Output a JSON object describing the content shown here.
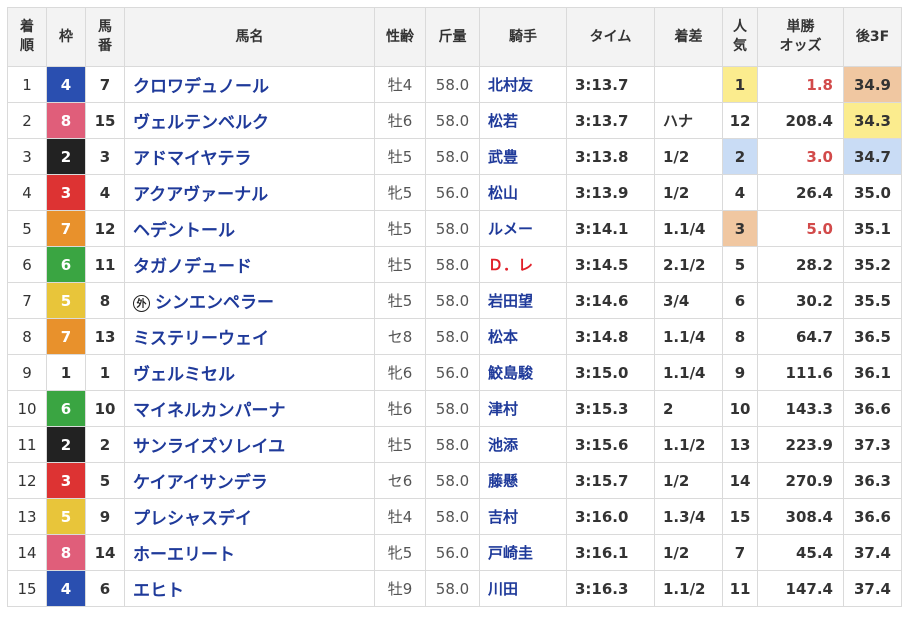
{
  "headers": {
    "rank": "着\n順",
    "waku": "枠",
    "umaban": "馬\n番",
    "name": "馬名",
    "sexage": "性齢",
    "weight": "斤量",
    "jockey": "騎手",
    "time": "タイム",
    "margin": "着差",
    "pop": "人\n気",
    "odds": "単勝\nオッズ",
    "last3f": "後3F"
  },
  "waku_colors": {
    "1": {
      "bg": "#ffffff",
      "fg": "#333333"
    },
    "2": {
      "bg": "#222222",
      "fg": "#ffffff"
    },
    "3": {
      "bg": "#dd3333",
      "fg": "#ffffff"
    },
    "4": {
      "bg": "#2a4fb0",
      "fg": "#ffffff"
    },
    "5": {
      "bg": "#e8c53a",
      "fg": "#ffffff"
    },
    "6": {
      "bg": "#3aa542",
      "fg": "#ffffff"
    },
    "7": {
      "bg": "#e8912c",
      "fg": "#ffffff"
    },
    "8": {
      "bg": "#e05e7a",
      "fg": "#ffffff"
    }
  },
  "highlight_colors": {
    "gold": "#fbec8e",
    "silver": "#c9dcf5",
    "bronze": "#f0c7a1"
  },
  "rows": [
    {
      "rank": "1",
      "waku": "4",
      "umaban": "7",
      "name": "クロワデュノール",
      "foreign": false,
      "sexage": "牡4",
      "weight": "58.0",
      "jockey": "北村友",
      "jockey_red": false,
      "time": "3:13.7",
      "margin": "",
      "pop": "1",
      "odds": "1.8",
      "odds_red": true,
      "last3f": "34.9",
      "pop_hl": "gold",
      "last3f_hl": "bronze"
    },
    {
      "rank": "2",
      "waku": "8",
      "umaban": "15",
      "name": "ヴェルテンベルク",
      "foreign": false,
      "sexage": "牡6",
      "weight": "58.0",
      "jockey": "松若",
      "jockey_red": false,
      "time": "3:13.7",
      "margin": "ハナ",
      "pop": "12",
      "odds": "208.4",
      "odds_red": false,
      "last3f": "34.3",
      "pop_hl": "",
      "last3f_hl": "gold"
    },
    {
      "rank": "3",
      "waku": "2",
      "umaban": "3",
      "name": "アドマイヤテラ",
      "foreign": false,
      "sexage": "牡5",
      "weight": "58.0",
      "jockey": "武豊",
      "jockey_red": false,
      "time": "3:13.8",
      "margin": "1/2",
      "pop": "2",
      "odds": "3.0",
      "odds_red": true,
      "last3f": "34.7",
      "pop_hl": "silver",
      "last3f_hl": "silver"
    },
    {
      "rank": "4",
      "waku": "3",
      "umaban": "4",
      "name": "アクアヴァーナル",
      "foreign": false,
      "sexage": "牝5",
      "weight": "56.0",
      "jockey": "松山",
      "jockey_red": false,
      "time": "3:13.9",
      "margin": "1/2",
      "pop": "4",
      "odds": "26.4",
      "odds_red": false,
      "last3f": "35.0",
      "pop_hl": "",
      "last3f_hl": ""
    },
    {
      "rank": "5",
      "waku": "7",
      "umaban": "12",
      "name": "ヘデントール",
      "foreign": false,
      "sexage": "牡5",
      "weight": "58.0",
      "jockey": "ルメー",
      "jockey_red": false,
      "time": "3:14.1",
      "margin": "1.1/4",
      "pop": "3",
      "odds": "5.0",
      "odds_red": true,
      "last3f": "35.1",
      "pop_hl": "bronze",
      "last3f_hl": ""
    },
    {
      "rank": "6",
      "waku": "6",
      "umaban": "11",
      "name": "タガノデュード",
      "foreign": false,
      "sexage": "牡5",
      "weight": "58.0",
      "jockey": "Ｄ．レ",
      "jockey_red": true,
      "time": "3:14.5",
      "margin": "2.1/2",
      "pop": "5",
      "odds": "28.2",
      "odds_red": false,
      "last3f": "35.2",
      "pop_hl": "",
      "last3f_hl": ""
    },
    {
      "rank": "7",
      "waku": "5",
      "umaban": "8",
      "name": "シンエンペラー",
      "foreign": true,
      "foreign_mark": "外",
      "sexage": "牡5",
      "weight": "58.0",
      "jockey": "岩田望",
      "jockey_red": false,
      "time": "3:14.6",
      "margin": "3/4",
      "pop": "6",
      "odds": "30.2",
      "odds_red": false,
      "last3f": "35.5",
      "pop_hl": "",
      "last3f_hl": ""
    },
    {
      "rank": "8",
      "waku": "7",
      "umaban": "13",
      "name": "ミステリーウェイ",
      "foreign": false,
      "sexage": "セ8",
      "weight": "58.0",
      "jockey": "松本",
      "jockey_red": false,
      "time": "3:14.8",
      "margin": "1.1/4",
      "pop": "8",
      "odds": "64.7",
      "odds_red": false,
      "last3f": "36.5",
      "pop_hl": "",
      "last3f_hl": ""
    },
    {
      "rank": "9",
      "waku": "1",
      "umaban": "1",
      "name": "ヴェルミセル",
      "foreign": false,
      "sexage": "牝6",
      "weight": "56.0",
      "jockey": "鮫島駿",
      "jockey_red": false,
      "time": "3:15.0",
      "margin": "1.1/4",
      "pop": "9",
      "odds": "111.6",
      "odds_red": false,
      "last3f": "36.1",
      "pop_hl": "",
      "last3f_hl": ""
    },
    {
      "rank": "10",
      "waku": "6",
      "umaban": "10",
      "name": "マイネルカンパーナ",
      "foreign": false,
      "sexage": "牡6",
      "weight": "58.0",
      "jockey": "津村",
      "jockey_red": false,
      "time": "3:15.3",
      "margin": "2",
      "pop": "10",
      "odds": "143.3",
      "odds_red": false,
      "last3f": "36.6",
      "pop_hl": "",
      "last3f_hl": ""
    },
    {
      "rank": "11",
      "waku": "2",
      "umaban": "2",
      "name": "サンライズソレイユ",
      "foreign": false,
      "sexage": "牡5",
      "weight": "58.0",
      "jockey": "池添",
      "jockey_red": false,
      "time": "3:15.6",
      "margin": "1.1/2",
      "pop": "13",
      "odds": "223.9",
      "odds_red": false,
      "last3f": "37.3",
      "pop_hl": "",
      "last3f_hl": ""
    },
    {
      "rank": "12",
      "waku": "3",
      "umaban": "5",
      "name": "ケイアイサンデラ",
      "foreign": false,
      "sexage": "セ6",
      "weight": "58.0",
      "jockey": "藤懸",
      "jockey_red": false,
      "time": "3:15.7",
      "margin": "1/2",
      "pop": "14",
      "odds": "270.9",
      "odds_red": false,
      "last3f": "36.3",
      "pop_hl": "",
      "last3f_hl": ""
    },
    {
      "rank": "13",
      "waku": "5",
      "umaban": "9",
      "name": "プレシャスデイ",
      "foreign": false,
      "sexage": "牡4",
      "weight": "58.0",
      "jockey": "吉村",
      "jockey_red": false,
      "time": "3:16.0",
      "margin": "1.3/4",
      "pop": "15",
      "odds": "308.4",
      "odds_red": false,
      "last3f": "36.6",
      "pop_hl": "",
      "last3f_hl": ""
    },
    {
      "rank": "14",
      "waku": "8",
      "umaban": "14",
      "name": "ホーエリート",
      "foreign": false,
      "sexage": "牝5",
      "weight": "56.0",
      "jockey": "戸崎圭",
      "jockey_red": false,
      "time": "3:16.1",
      "margin": "1/2",
      "pop": "7",
      "odds": "45.4",
      "odds_red": false,
      "last3f": "37.4",
      "pop_hl": "",
      "last3f_hl": ""
    },
    {
      "rank": "15",
      "waku": "4",
      "umaban": "6",
      "name": "エヒト",
      "foreign": false,
      "sexage": "牡9",
      "weight": "58.0",
      "jockey": "川田",
      "jockey_red": false,
      "time": "3:16.3",
      "margin": "1.1/2",
      "pop": "11",
      "odds": "147.4",
      "odds_red": false,
      "last3f": "37.4",
      "pop_hl": "",
      "last3f_hl": ""
    }
  ]
}
